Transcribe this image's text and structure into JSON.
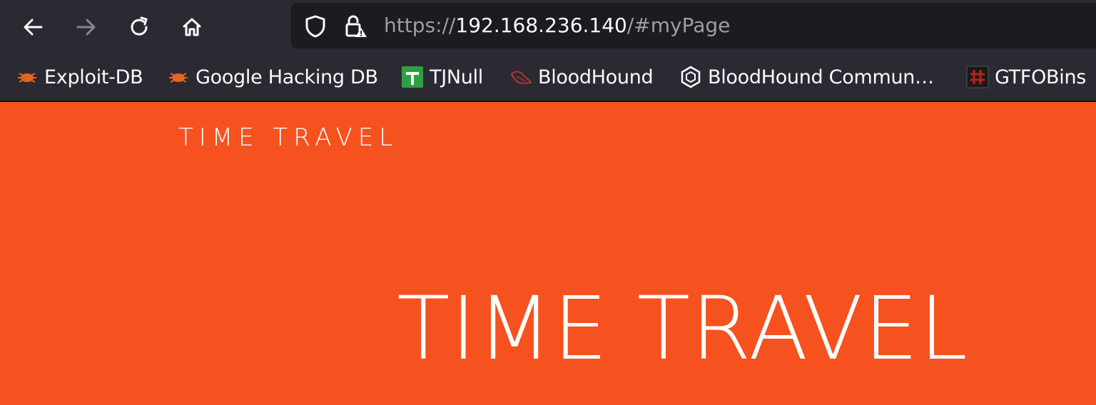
{
  "browser": {
    "nav": {
      "back_icon": "arrow-left-icon",
      "forward_icon": "arrow-right-icon",
      "reload_icon": "reload-icon",
      "home_icon": "home-icon"
    },
    "url": {
      "scheme": "https://",
      "host": "192.168.236.140",
      "path": "/#myPage",
      "shield_icon": "shield-icon",
      "lock_icon": "lock-warning-icon"
    },
    "bookmarks": [
      {
        "label": "Exploit-DB",
        "icon": "bug-icon",
        "color": "#e8641e"
      },
      {
        "label": "Google Hacking DB",
        "icon": "bug-icon",
        "color": "#e8641e"
      },
      {
        "label": "TJNull",
        "icon": "green-cross-icon",
        "color": "#2ea043"
      },
      {
        "label": "BloodHound",
        "icon": "bloodhound-icon",
        "color": "#b0342f"
      },
      {
        "label": "BloodHound Commun…",
        "icon": "hexagon-icon",
        "color": "#fbfbfe"
      },
      {
        "label": "GTFOBins",
        "icon": "gtfobins-icon",
        "color": "#c0201b"
      }
    ]
  },
  "page": {
    "brand": "TIME TRAVEL",
    "hero_title": "TIME TRAVEL",
    "background_color": "#f5521f"
  }
}
